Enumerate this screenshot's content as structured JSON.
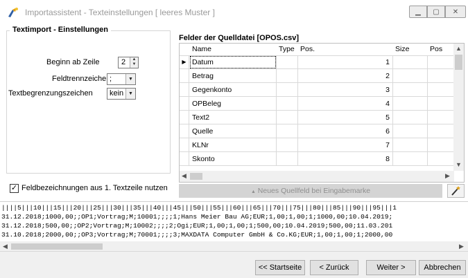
{
  "window": {
    "title": "Importassistent - Texteinstellungen [ leeres Muster ]"
  },
  "settings": {
    "group_title": "Textimport - Einstellungen",
    "start_row_label": "Beginn ab Zeile",
    "start_row_value": "2",
    "delimiter_label": "Feldtrennzeichen",
    "delimiter_value": ";",
    "text_qualifier_label": "Textbegrenzungszeichen",
    "text_qualifier_value": "kein",
    "header_checkbox_label": "Feldbezeichnungen aus 1. Textzeile nutzen",
    "header_checkbox_checked": true
  },
  "grid": {
    "title": "Felder der Quelldatei [OPOS.csv]",
    "columns": [
      "Name",
      "Type",
      "Pos.",
      "Size",
      "Pos"
    ],
    "rows": [
      {
        "name": "Datum",
        "type": "",
        "pos": "1",
        "size": "",
        "pos2": ""
      },
      {
        "name": "Betrag",
        "type": "",
        "pos": "2",
        "size": "",
        "pos2": ""
      },
      {
        "name": "Gegenkonto",
        "type": "",
        "pos": "3",
        "size": "",
        "pos2": ""
      },
      {
        "name": "OPBeleg",
        "type": "",
        "pos": "4",
        "size": "",
        "pos2": ""
      },
      {
        "name": "Text2",
        "type": "",
        "pos": "5",
        "size": "",
        "pos2": ""
      },
      {
        "name": "Quelle",
        "type": "",
        "pos": "6",
        "size": "",
        "pos2": ""
      },
      {
        "name": "KLNr",
        "type": "",
        "pos": "7",
        "size": "",
        "pos2": ""
      },
      {
        "name": "Skonto",
        "type": "",
        "pos": "8",
        "size": "",
        "pos2": ""
      }
    ],
    "new_field_label": "Neues Quellfeld bei Eingabemarke"
  },
  "preview": {
    "lines": [
      "||||5|||10|||15|||20|||25|||30|||35|||40|||45|||50|||55|||60|||65|||70|||75|||80|||85|||90|||95|||1",
      "31.12.2018;1000,00;;OP1;Vortrag;M;10001;;;;1;Hans Meier Bau AG;EUR;1,00;1,00;1;1000,00;10.04.2019;",
      "31.12.2018;500,00;;OP2;Vortrag;M;10002;;;;2;Ogi;EUR;1,00;1,00;1;500,00;10.04.2019;500,00;11.03.201",
      "31.10.2018;2000,00;;OP3;Vortrag;M;70001;;;;3;MAXDATA Computer GmbH & Co.KG;EUR;1,00;1,00;1;2000,00"
    ]
  },
  "footer": {
    "start_label": "<< Startseite",
    "back_label": "< Zurück",
    "next_label": "Weiter >",
    "cancel_label": "Abbrechen"
  }
}
